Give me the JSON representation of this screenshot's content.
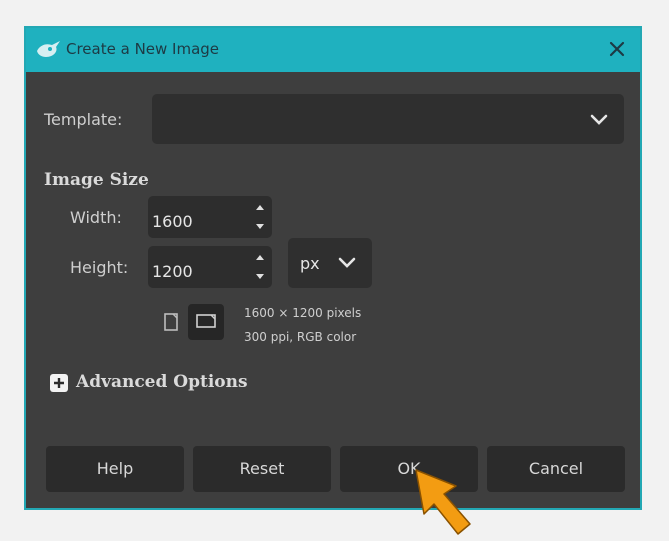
{
  "window": {
    "title": "Create a New Image"
  },
  "template": {
    "label": "Template:",
    "value": ""
  },
  "image_size": {
    "section_title": "Image Size",
    "width_label": "Width:",
    "width_value": "1600",
    "height_label": "Height:",
    "height_value": "1200",
    "unit": "px",
    "info_line1": "1600 × 1200 pixels",
    "info_line2": "300 ppi, RGB color"
  },
  "advanced": {
    "label": "Advanced Options"
  },
  "buttons": {
    "help": "Help",
    "reset": "Reset",
    "ok": "OK",
    "cancel": "Cancel"
  },
  "colors": {
    "titlebar": "#1fb1bf",
    "dialog_bg": "#3e3e3e",
    "cursor": "#f39c12"
  },
  "icons": {
    "title": "gimp-logo-icon",
    "close": "close-icon",
    "template_dropdown": "chevron-down-icon",
    "unit_dropdown": "chevron-down-icon",
    "portrait": "portrait-orientation-icon",
    "landscape": "landscape-orientation-icon",
    "advanced": "expand-plus-icon",
    "pointer": "mouse-cursor-icon"
  }
}
